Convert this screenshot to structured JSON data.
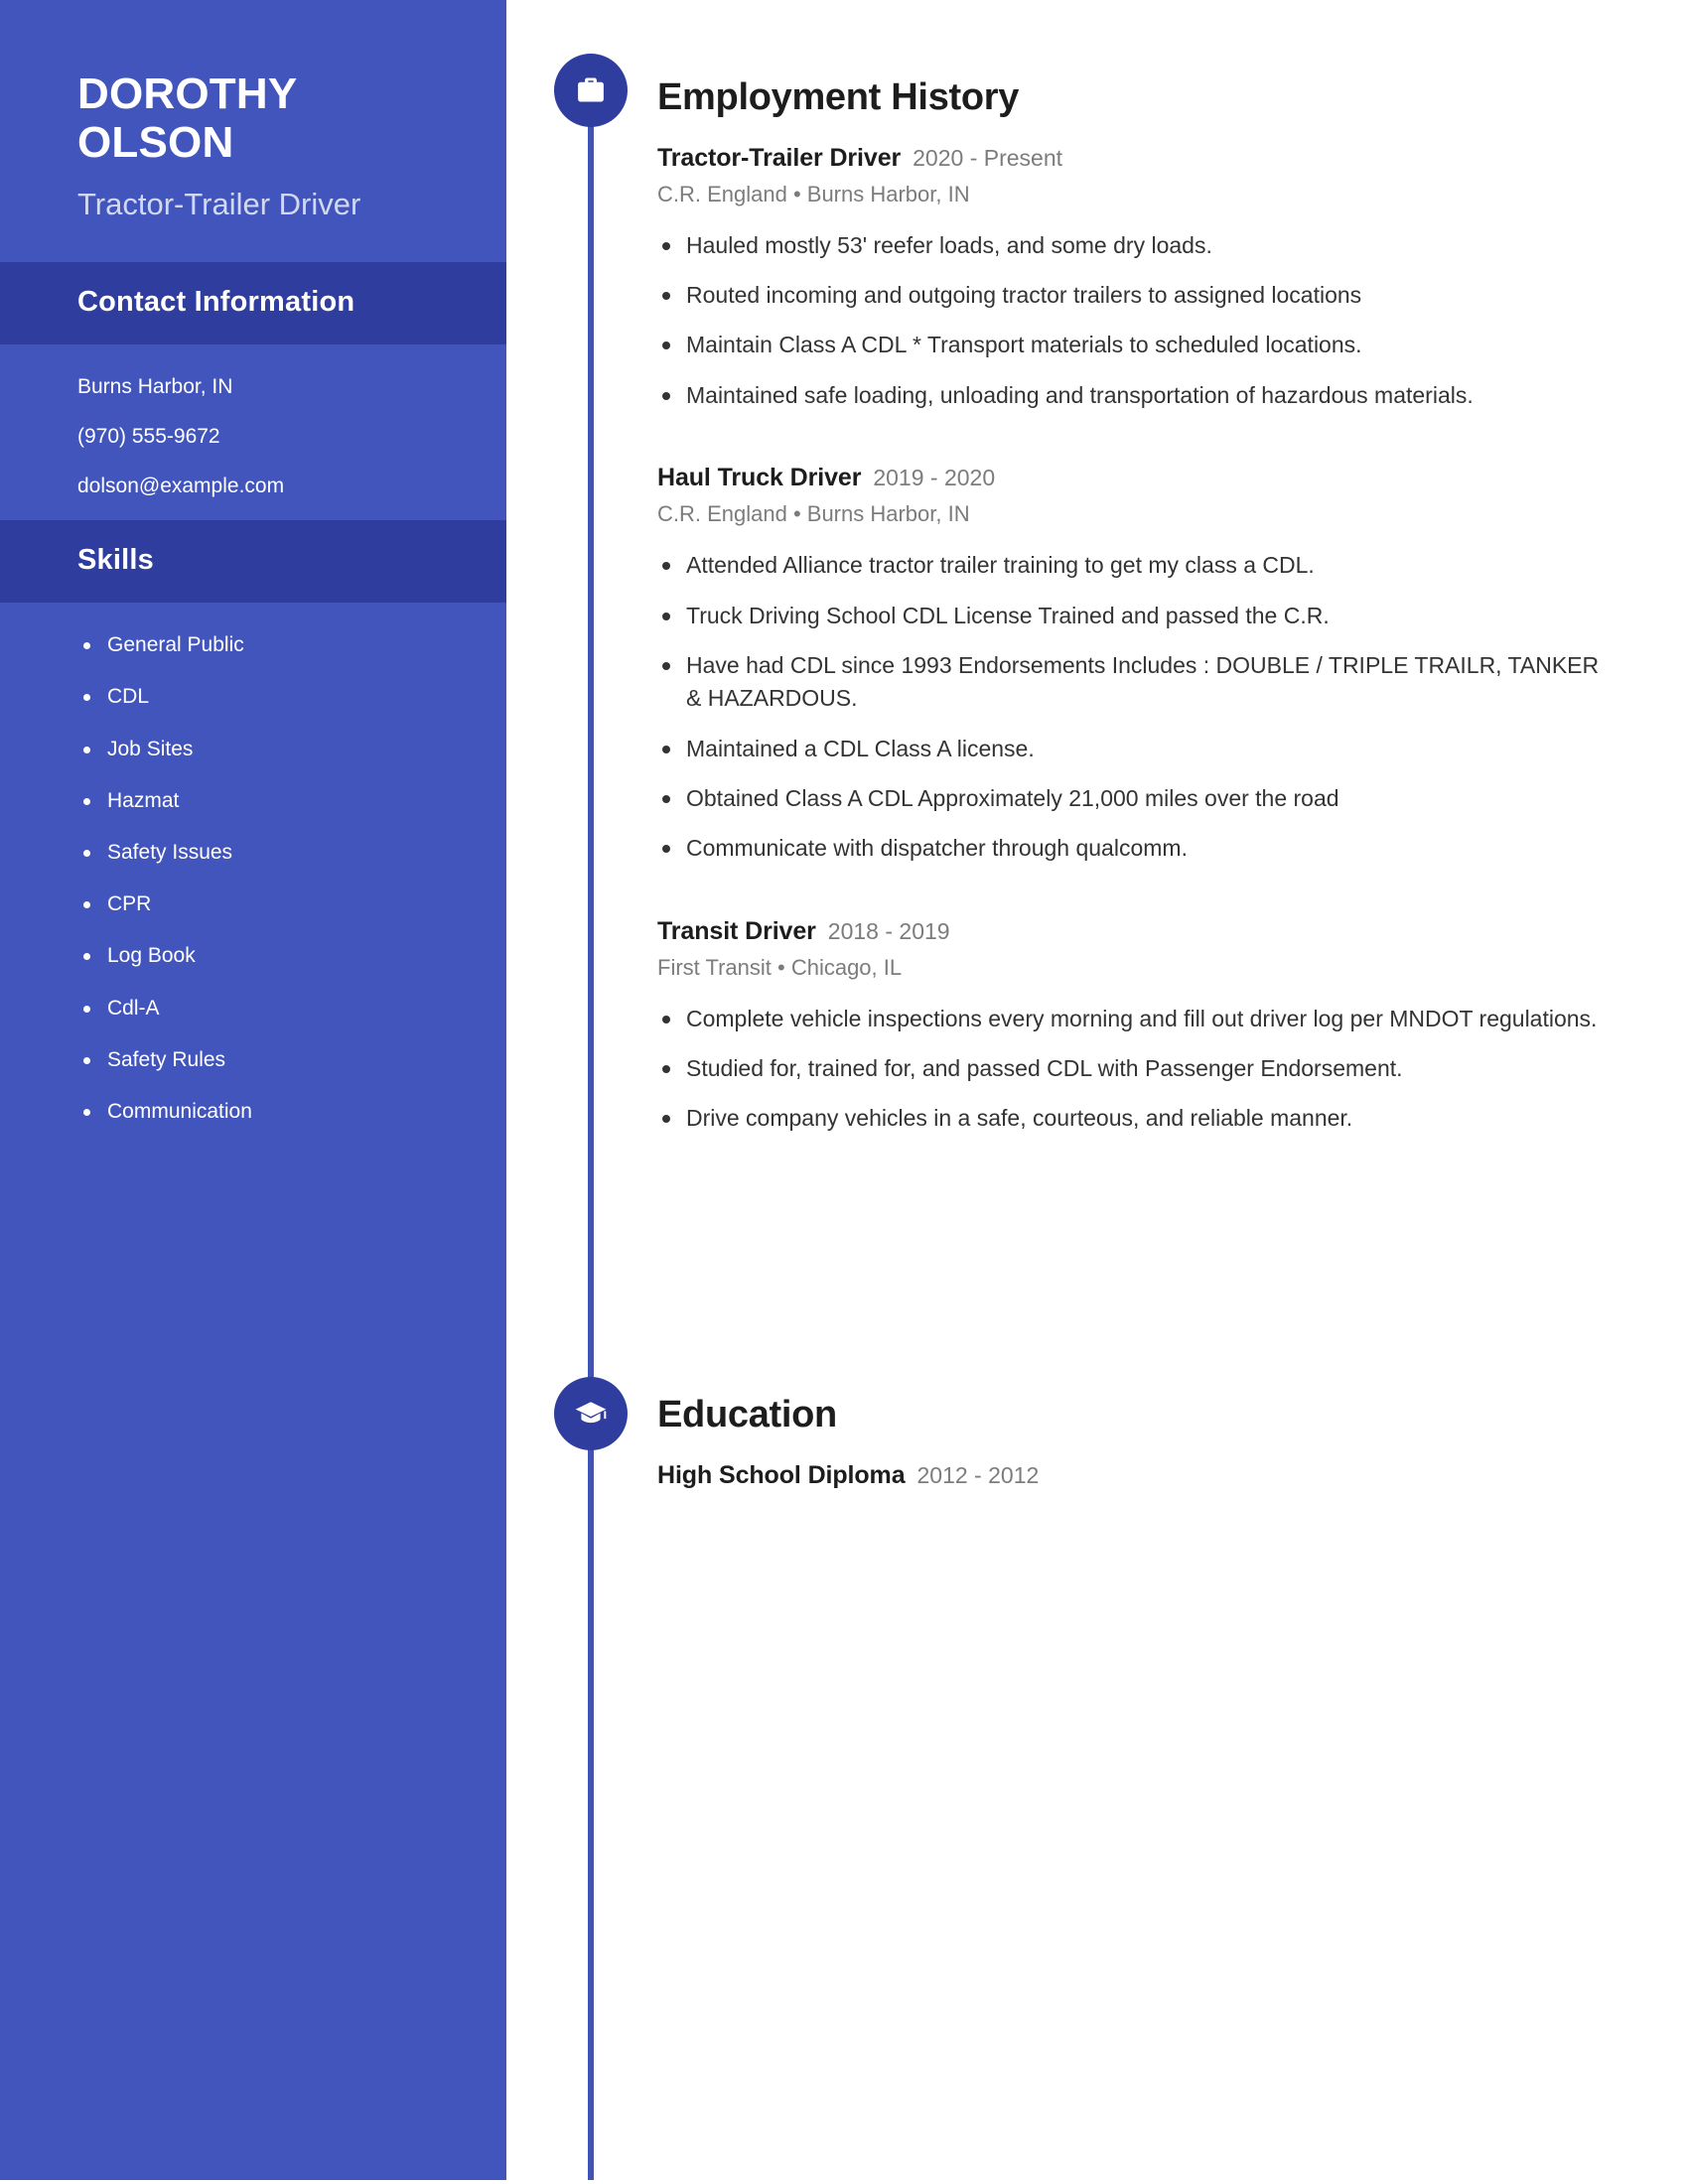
{
  "sidebar": {
    "name": "DOROTHY OLSON",
    "title": "Tractor-Trailer Driver",
    "contact": {
      "heading": "Contact Information",
      "lines": [
        "Burns Harbor, IN",
        "(970) 555-9672",
        "dolson@example.com"
      ]
    },
    "skills": {
      "heading": "Skills",
      "items": [
        "General Public",
        "CDL",
        "Job Sites",
        "Hazmat",
        "Safety Issues",
        "CPR",
        "Log Book",
        "Cdl-A",
        "Safety Rules",
        "Communication"
      ]
    }
  },
  "main": {
    "employment": {
      "heading": "Employment History",
      "icon": "briefcase-icon",
      "entries": [
        {
          "role": "Tractor-Trailer Driver",
          "dates": "2020 - Present",
          "meta": "C.R. England  •  Burns Harbor, IN",
          "bullets": [
            "Hauled mostly 53' reefer loads, and some dry loads.",
            "Routed incoming and outgoing tractor trailers to assigned locations",
            "Maintain Class A CDL * Transport materials to scheduled locations.",
            "Maintained safe loading, unloading and transportation of hazardous materials."
          ]
        },
        {
          "role": "Haul Truck Driver",
          "dates": "2019 - 2020",
          "meta": "C.R. England  •  Burns Harbor, IN",
          "bullets": [
            "Attended Alliance tractor trailer training to get my class a CDL.",
            "Truck Driving School CDL License Trained and passed the C.R.",
            "Have had CDL since 1993 Endorsements Includes : DOUBLE / TRIPLE TRAILR, TANKER & HAZARDOUS.",
            "Maintained a CDL Class A license.",
            "Obtained Class A CDL Approximately 21,000 miles over the road",
            "Communicate with dispatcher through qualcomm."
          ]
        },
        {
          "role": "Transit Driver",
          "dates": "2018 - 2019",
          "meta": "First Transit  •  Chicago, IL",
          "bullets": [
            "Complete vehicle inspections every morning and fill out driver log per MNDOT regulations.",
            "Studied for, trained for, and passed CDL with Passenger Endorsement.",
            "Drive company vehicles in a safe, courteous, and reliable manner."
          ]
        }
      ]
    },
    "education": {
      "heading": "Education",
      "icon": "graduation-cap-icon",
      "entries": [
        {
          "role": "High School Diploma",
          "dates": "2012 - 2012",
          "meta": "",
          "bullets": []
        }
      ]
    }
  },
  "colors": {
    "sidebar_bg": "#4255bc",
    "sidebar_band": "#2f3d9e",
    "accent": "#4054b8",
    "node_bg": "#2f3d9e",
    "text_dark": "#1d1d1d",
    "text_muted": "#7c7c7c",
    "text_body": "#333333",
    "sidebar_subtitle": "#d3d8f1"
  }
}
